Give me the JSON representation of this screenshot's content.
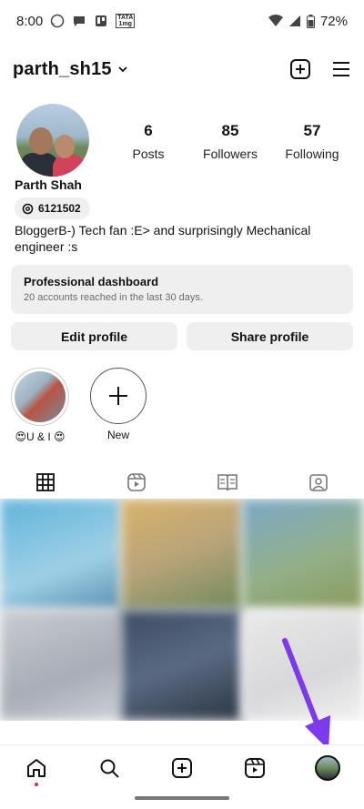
{
  "status_bar": {
    "time": "8:00",
    "carrier_badge": "TATA\n1mg",
    "battery": "72%"
  },
  "header": {
    "username": "parth_sh15"
  },
  "profile": {
    "display_name": "Parth Shah",
    "threads_id": "6121502",
    "bio": "BloggerB-) Tech fan :E> and surprisingly Mechanical engineer :s",
    "stats": [
      {
        "value": "6",
        "label": "Posts"
      },
      {
        "value": "85",
        "label": "Followers"
      },
      {
        "value": "57",
        "label": "Following"
      }
    ]
  },
  "professional_dashboard": {
    "title": "Professional dashboard",
    "subtitle": "20 accounts reached in the last 30 days."
  },
  "buttons": {
    "edit_profile": "Edit profile",
    "share_profile": "Share profile"
  },
  "highlights": [
    {
      "label": "😍U & I 😍"
    },
    {
      "label": "New"
    }
  ],
  "tabs": [
    "grid-icon",
    "reels-icon",
    "guides-icon",
    "tagged-icon"
  ],
  "bottom_nav": [
    "home-icon",
    "search-icon",
    "create-icon",
    "reels-icon",
    "profile-avatar"
  ],
  "colors": {
    "accent_arrow": "#7c3aed",
    "notification_dot": "#e0245e",
    "button_bg": "#efefef"
  }
}
